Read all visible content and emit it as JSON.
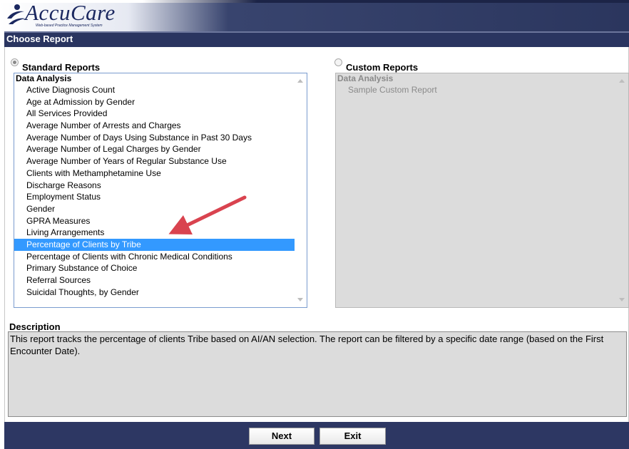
{
  "header": {
    "app_name": "AccuCare",
    "tagline": "Web-based Practice Management System"
  },
  "titlebar": {
    "title": "Choose Report"
  },
  "standard_reports": {
    "label": "Standard Reports",
    "selected": true,
    "group": "Data Analysis",
    "items": [
      "Active Diagnosis Count",
      "Age at Admission by Gender",
      "All Services Provided",
      "Average Number of Arrests and Charges",
      "Average Number of Days Using Substance in Past 30 Days",
      "Average Number of Legal Charges by Gender",
      "Average Number of Years of Regular Substance Use",
      "Clients with Methamphetamine Use",
      "Discharge Reasons",
      "Employment Status",
      "Gender",
      "GPRA Measures",
      "Living Arrangements",
      "Percentage of Clients by Tribe",
      "Percentage of Clients with Chronic Medical Conditions",
      "Primary Substance of Choice",
      "Referral Sources",
      "Suicidal Thoughts, by Gender"
    ],
    "selected_item": "Percentage of Clients by Tribe"
  },
  "custom_reports": {
    "label": "Custom Reports",
    "selected": false,
    "group": "Data Analysis",
    "items": [
      "Sample Custom Report"
    ]
  },
  "description": {
    "label": "Description",
    "text": "This report tracks the percentage of clients Tribe based on AI/AN selection. The report can be filtered by a specific date range (based on the First Encounter Date)."
  },
  "footer": {
    "next_label": "Next",
    "exit_label": "Exit"
  },
  "colors": {
    "brand_navy": "#2a3560",
    "selection_blue": "#3399ff",
    "annotation_arrow": "#d9434f"
  }
}
